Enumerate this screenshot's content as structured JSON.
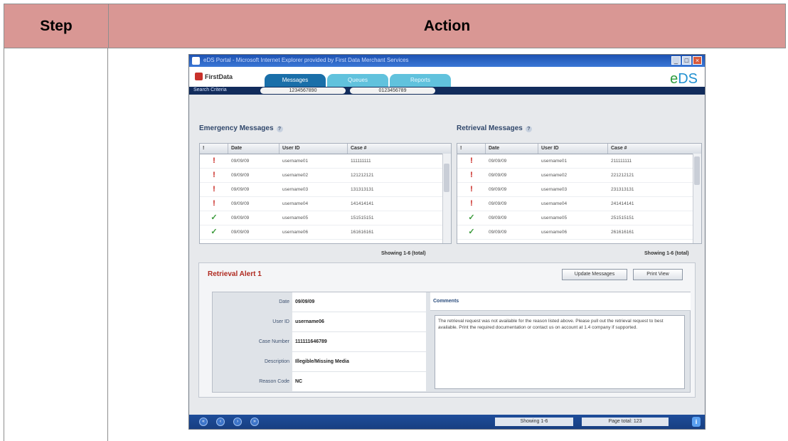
{
  "table": {
    "header_step": "Step",
    "header_action": "Action"
  },
  "app": {
    "window_title": "eDS Portal - Microsoft Internet Explorer provided by First Data Merchant Services",
    "logo_text": "FirstData",
    "brand": {
      "prefix": "e",
      "suffix": "DS"
    },
    "tabs": [
      {
        "label": "Messages",
        "active": true
      },
      {
        "label": "Queues",
        "active": false
      },
      {
        "label": "Reports",
        "active": false
      }
    ],
    "nav": {
      "label": "Search Criteria",
      "pill_1": "1234567890",
      "pill_2": "0123456789"
    },
    "emergency": {
      "title": "Emergency Messages",
      "columns": [
        "!",
        "Date",
        "User ID",
        "Case #"
      ],
      "rows": [
        {
          "flag": "!",
          "date": "09/09/09",
          "user": "username01",
          "case": "111111111"
        },
        {
          "flag": "!",
          "date": "09/09/09",
          "user": "username02",
          "case": "121212121"
        },
        {
          "flag": "!",
          "date": "09/09/09",
          "user": "username03",
          "case": "131313131"
        },
        {
          "flag": "!",
          "date": "09/09/09",
          "user": "username04",
          "case": "141414141"
        },
        {
          "flag": "✓",
          "date": "09/09/09",
          "user": "username05",
          "case": "151515151"
        },
        {
          "flag": "✓",
          "date": "09/09/09",
          "user": "username06",
          "case": "161616161"
        }
      ],
      "showing": "Showing 1-6 (total)"
    },
    "retrieval": {
      "title": "Retrieval Messages",
      "columns": [
        "!",
        "Date",
        "User ID",
        "Case #"
      ],
      "rows": [
        {
          "flag": "!",
          "date": "09/09/09",
          "user": "username01",
          "case": "211111111"
        },
        {
          "flag": "!",
          "date": "09/09/09",
          "user": "username02",
          "case": "221212121"
        },
        {
          "flag": "!",
          "date": "09/09/09",
          "user": "username03",
          "case": "231313131"
        },
        {
          "flag": "!",
          "date": "09/09/09",
          "user": "username04",
          "case": "241414141"
        },
        {
          "flag": "✓",
          "date": "09/09/09",
          "user": "username05",
          "case": "251515151"
        },
        {
          "flag": "✓",
          "date": "09/09/09",
          "user": "username06",
          "case": "261616161"
        }
      ],
      "showing": "Showing 1-6 (total)"
    },
    "details": {
      "title": "Retrieval Alert",
      "title_count": "1",
      "btn_update": "Update Messages",
      "btn_print": "Print View",
      "fields": [
        {
          "label": "Date",
          "value": "09/09/09"
        },
        {
          "label": "User ID",
          "value": "username06"
        },
        {
          "label": "Case Number",
          "value": "111111646789"
        },
        {
          "label": "Description",
          "value": "Illegible/Missing Media"
        },
        {
          "label": "Reason Code",
          "value": "NC"
        }
      ],
      "comment_head": "Comments",
      "comment_text": "The retrieval request was not available for the reason listed above. Please pull out the retrieval request to best available. Print the required documentation or contact us on account at 1.4 company if supported."
    },
    "statusbar": {
      "buttons": [
        "«",
        "‹",
        "›",
        "»"
      ],
      "field_1": "Showing 1-6",
      "field_2": "Page total: 123",
      "info": "i"
    }
  }
}
